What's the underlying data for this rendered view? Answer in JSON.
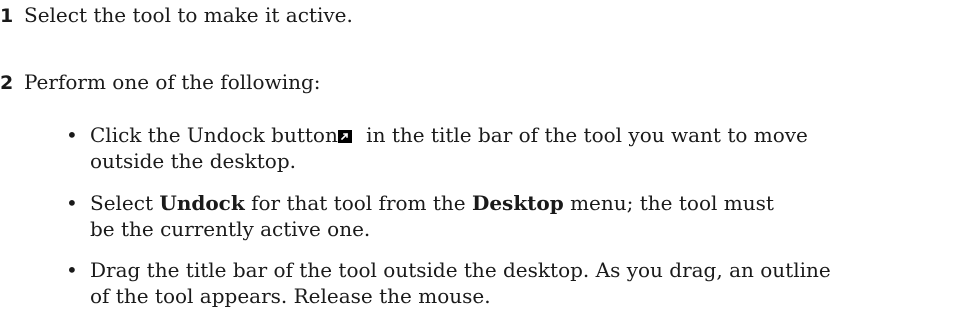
{
  "steps": [
    {
      "number": "1",
      "text": "Select the tool to make it active."
    },
    {
      "number": "2",
      "text": "Perform one of the following:"
    }
  ],
  "bullets": [
    {
      "line1_before_icon": "Click the Undock button",
      "icon": "undock-icon",
      "line1_after_icon": " in the title bar of the tool you want to move",
      "line2": "outside the desktop."
    },
    {
      "line1_part1": "Select ",
      "line1_bold1": "Undock",
      "line1_part2": " for that tool from the ",
      "line1_bold2": "Desktop",
      "line1_part3": " menu; the tool must",
      "line2": "be the currently active one."
    },
    {
      "line1": "Drag the title bar of the tool outside the desktop. As you drag, an outline",
      "line2": "of the tool appears. Release the mouse."
    }
  ],
  "bullet_glyph": "•"
}
